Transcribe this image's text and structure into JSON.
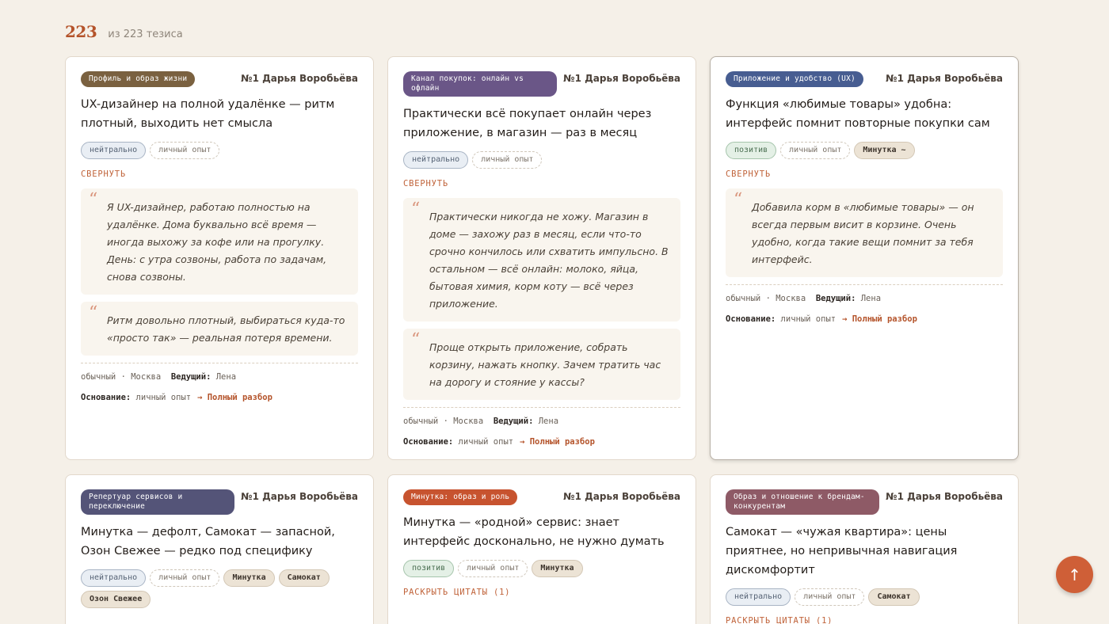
{
  "header": {
    "count": "223",
    "label": "из 223 тезиса"
  },
  "colors": {
    "accent": "#b4532a",
    "cat_profile": "#7a6140",
    "cat_channel": "#6a5687",
    "cat_ux": "#475d91",
    "cat_services": "#545478",
    "cat_minutka": "#c7532f",
    "cat_competitors": "#8e5a66"
  },
  "cards": [
    {
      "category": "Профиль и образ жизни",
      "author": "№1 Дарья Воробьёва",
      "title": "UX-дизайнер на полной удалёнке — ритм плотный, выходить нет смысла",
      "tags": [
        "нейтрально",
        "личный опыт"
      ],
      "toggle": "СВЕРНУТЬ",
      "quotes": [
        "Я UX-дизайнер, работаю полностью на удалёнке. Дома буквально всё время — иногда выхожу за кофе или на прогулку. День: с утра созвоны, работа по задачам, снова созвоны.",
        "Ритм довольно плотный, выбираться куда-то «просто так» — реальная потеря времени."
      ],
      "meta": {
        "segment": "обычный",
        "city": "Москва",
        "host_label": "Ведущий:",
        "host": "Лена"
      },
      "basis": {
        "label": "Основание:",
        "value": "личный опыт",
        "link": "→ Полный разбор"
      }
    },
    {
      "category": "Канал покупок: онлайн vs офлайн",
      "author": "№1 Дарья Воробьёва",
      "title": "Практически всё покупает онлайн через приложение, в магазин — раз в месяц",
      "tags": [
        "нейтрально",
        "личный опыт"
      ],
      "toggle": "СВЕРНУТЬ",
      "quotes": [
        "Практически никогда не хожу. Магазин в доме — захожу раз в месяц, если что-то срочно кончилось или схватить импульсно. В остальном — всё онлайн: молоко, яйца, бытовая химия, корм коту — всё через приложение.",
        "Проще открыть приложение, собрать корзину, нажать кнопку. Зачем тратить час на дорогу и стояние у кассы?"
      ],
      "meta": {
        "segment": "обычный",
        "city": "Москва",
        "host_label": "Ведущий:",
        "host": "Лена"
      },
      "basis": {
        "label": "Основание:",
        "value": "личный опыт",
        "link": "→ Полный разбор"
      }
    },
    {
      "category": "Приложение и удобство (UX)",
      "author": "№1 Дарья Воробьёва",
      "title": "Функция «любимые товары» удобна: интерфейс помнит повторные покупки сам",
      "tags": [
        "позитив",
        "личный опыт",
        "Минутка ~"
      ],
      "toggle": "СВЕРНУТЬ",
      "quotes": [
        "Добавила корм в «любимые товары» — он всегда первым висит в корзине. Очень удобно, когда такие вещи помнит за тебя интерфейс."
      ],
      "meta": {
        "segment": "обычный",
        "city": "Москва",
        "host_label": "Ведущий:",
        "host": "Лена"
      },
      "basis": {
        "label": "Основание:",
        "value": "личный опыт",
        "link": "→ Полный разбор"
      }
    },
    {
      "category": "Репертуар сервисов и переключение",
      "author": "№1 Дарья Воробьёва",
      "title": "Минутка — дефолт, Самокат — запасной, Озон Свежее — редко под специфику",
      "tags": [
        "нейтрально",
        "личный опыт",
        "Минутка",
        "Самокат",
        "Озон Свежее"
      ],
      "toggle": "",
      "quotes": []
    },
    {
      "category": "Минутка: образ и роль",
      "author": "№1 Дарья Воробьёва",
      "title": "Минутка — «родной» сервис: знает интерфейс досконально, не нужно думать",
      "tags": [
        "позитив",
        "личный опыт",
        "Минутка"
      ],
      "toggle": "РАСКРЫТЬ ЦИТАТЫ (1)",
      "quotes": []
    },
    {
      "category": "Образ и отношение к брендам-конкурентам",
      "author": "№1 Дарья Воробьёва",
      "title": "Самокат — «чужая квартира»: цены приятнее, но непривычная навигация дискомфортит",
      "tags": [
        "нейтрально",
        "личный опыт",
        "Самокат"
      ],
      "toggle": "РАСКРЫТЬ ЦИТАТЫ (1)",
      "quotes": []
    }
  ],
  "fab": {
    "icon": "arrow-up-icon",
    "glyph": "↑"
  }
}
